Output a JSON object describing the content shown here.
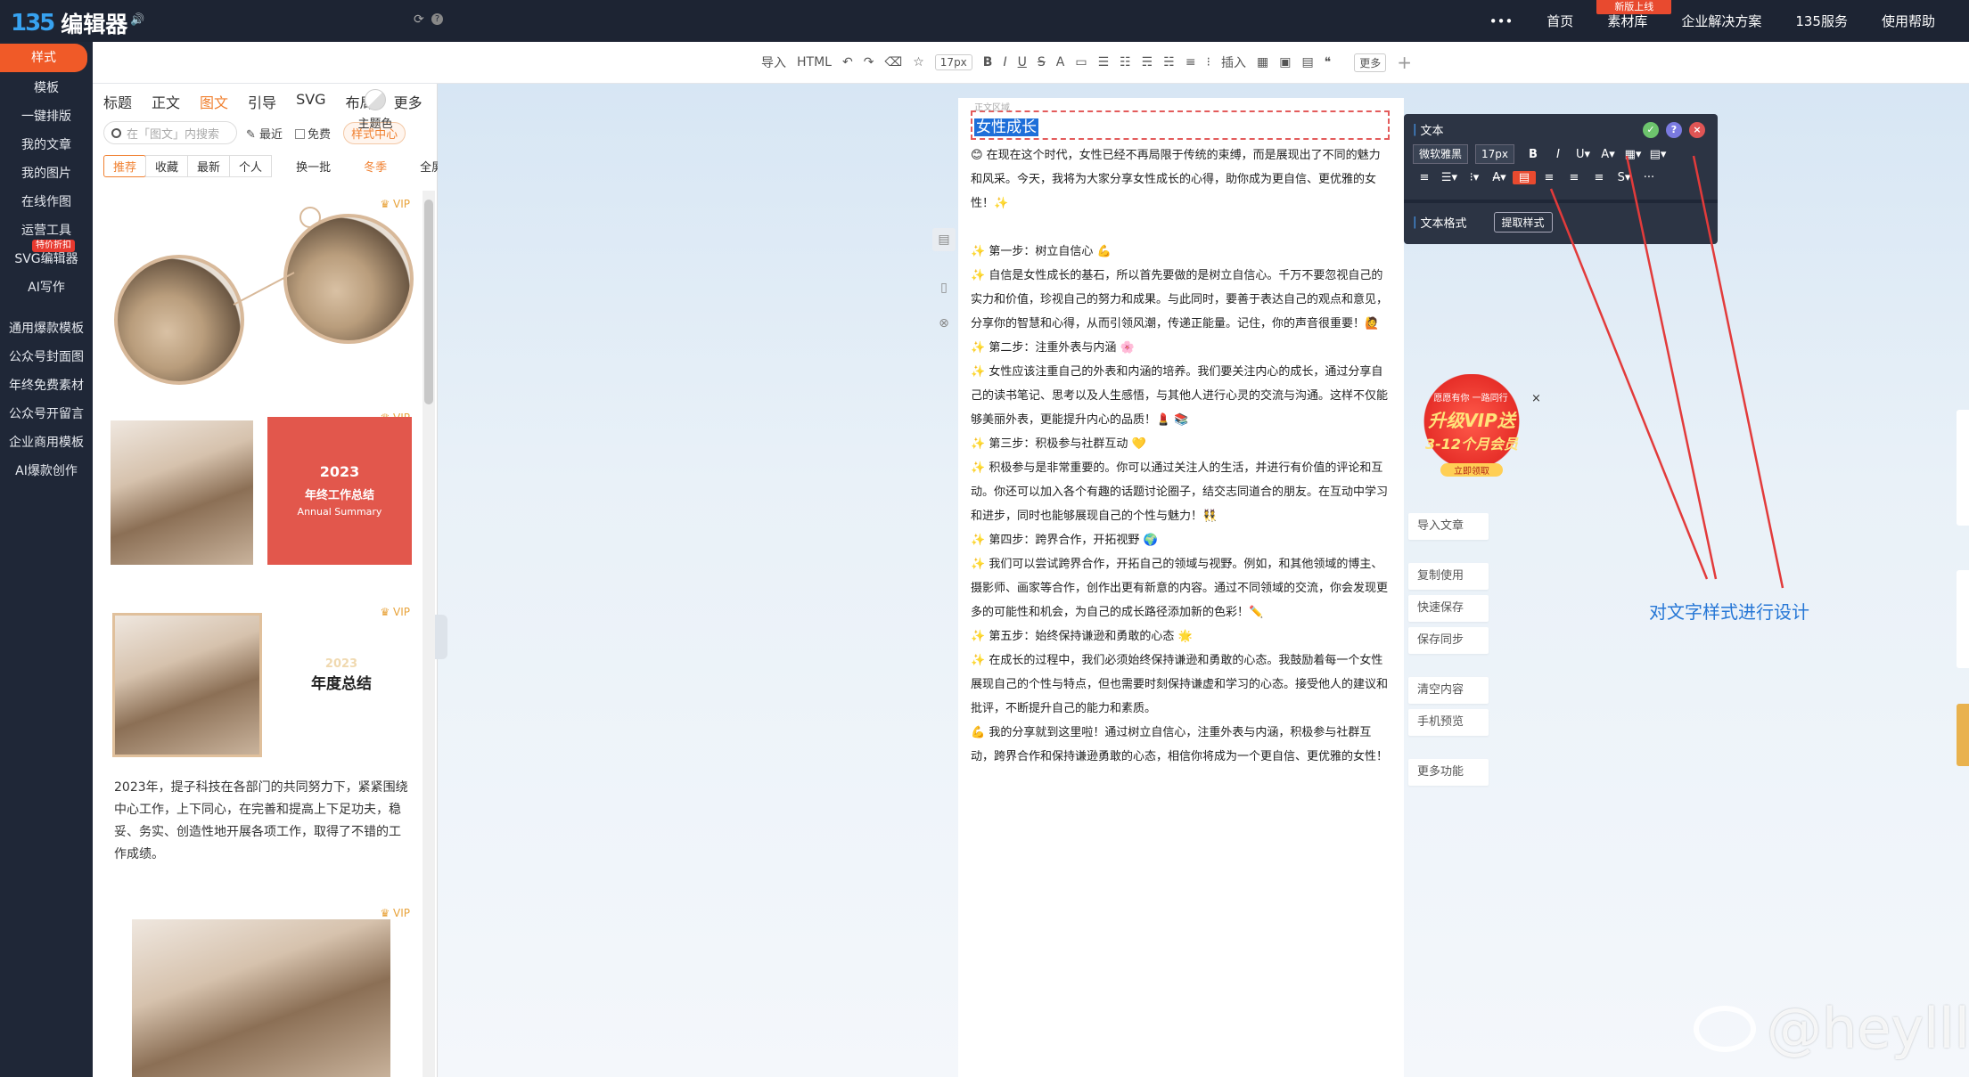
{
  "topbar": {
    "logo_mark": "135",
    "logo_text": "编辑器",
    "nav": [
      "•••",
      "首页",
      "素材库",
      "企业解决方案",
      "135服务",
      "使用帮助"
    ],
    "badge": "新版上线"
  },
  "sidebar": {
    "items": [
      "样式",
      "模板",
      "一键排版",
      "我的文章",
      "我的图片",
      "在线作图",
      "运营工具",
      "SVG编辑器",
      "AI写作"
    ],
    "hot_label": "特价折扣",
    "items2": [
      "通用爆款模板",
      "公众号封面图",
      "年终免费素材",
      "公众号开留言",
      "企业商用模板",
      "AI爆款创作"
    ]
  },
  "toolbar": {
    "items": [
      "导入",
      "HTML",
      "↶",
      "↷",
      "⌫",
      "☆",
      "17px",
      "B",
      "I",
      "U",
      "S",
      "A",
      "▭",
      "☰",
      "☷",
      "☴",
      "☵",
      "≡",
      "⁝",
      "插入",
      "▦",
      "▣",
      "▤",
      "❝"
    ],
    "more": "更多",
    "plus": "+"
  },
  "panel": {
    "tabs": [
      "标题",
      "正文",
      "图文",
      "引导",
      "SVG",
      "布局",
      "更多"
    ],
    "active_tab": 2,
    "theme": "主题色",
    "search_placeholder": "在「图文」内搜索",
    "recent": "最近",
    "free": "免费",
    "style_center": "样式中心",
    "subtabs": [
      "推荐",
      "收藏",
      "最新",
      "个人"
    ],
    "swap": "换一批",
    "winter": "冬季",
    "fullscreen": "全屏写作",
    "vip": "VIP",
    "card2": {
      "year": "2023",
      "title": "年终工作总结",
      "sub": "Annual Summary"
    },
    "card3": {
      "year": "2023",
      "title": "年度总结",
      "text": "2023年，提子科技在各部门的共同努力下，紧紧围绕中心工作，上下同心，在完善和提高上下足功夫，稳妥、务实、创造性地开展各项工作，取得了不错的工作成绩。"
    }
  },
  "doc": {
    "tiny": "正文区域",
    "title": "女性成长",
    "paragraphs": [
      "😊 在现在这个时代，女性已经不再局限于传统的束缚，而是展现出了不同的魅力和风采。今天，我将为大家分享女性成长的心得，助你成为更自信、更优雅的女性！✨",
      "",
      "✨ 第一步：树立自信心 💪",
      "✨ 自信是女性成长的基石，所以首先要做的是树立自信心。千万不要忽视自己的实力和价值，珍视自己的努力和成果。与此同时，要善于表达自己的观点和意见，分享你的智慧和心得，从而引领风潮，传递正能量。记住，你的声音很重要！🙋",
      "✨ 第二步：注重外表与内涵 🌸",
      "✨ 女性应该注重自己的外表和内涵的培养。我们要关注内心的成长，通过分享自己的读书笔记、思考以及人生感悟，与其他人进行心灵的交流与沟通。这样不仅能够美丽外表，更能提升内心的品质！💄 📚",
      "✨ 第三步：积极参与社群互动 💛",
      "✨ 积极参与是非常重要的。你可以通过关注人的生活，并进行有价值的评论和互动。你还可以加入各个有趣的话题讨论圈子，结交志同道合的朋友。在互动中学习和进步，同时也能够展现自己的个性与魅力！👯",
      "✨ 第四步：跨界合作，开拓视野 🌍",
      "✨ 我们可以尝试跨界合作，开拓自己的领域与视野。例如，和其他领域的博主、摄影师、画家等合作，创作出更有新意的内容。通过不同领域的交流，你会发现更多的可能性和机会，为自己的成长路径添加新的色彩！✏️",
      "✨ 第五步：始终保持谦逊和勇敢的心态 🌟",
      "✨ 在成长的过程中，我们必须始终保持谦逊和勇敢的心态。我鼓励着每一个女性展现自己的个性与特点，但也需要时刻保持谦虚和学习的心态。接受他人的建议和批评，不断提升自己的能力和素质。",
      "💪 我的分享就到这里啦！通过树立自信心，注重外表与内涵，积极参与社群互动，跨界合作和保持谦逊勇敢的心态，相信你将成为一个更自信、更优雅的女性！"
    ]
  },
  "format_toolbar": {
    "label": "文本",
    "font": "微软雅黑",
    "size": "17px",
    "row1": [
      "B",
      "I",
      "U▾",
      "A▾",
      "▦▾",
      "▤▾"
    ],
    "row2": [
      "≡",
      "☰▾",
      "⁝▾",
      "A̶▾",
      "▤",
      "≡",
      "≡",
      "≡",
      "S▾",
      "···"
    ],
    "label2": "文本格式",
    "extract": "提取样式"
  },
  "vip_ad": {
    "top": "愿愿有你 一路同行",
    "main": "升级VIP送",
    "sub": "3-12个月会员",
    "get": "立即领取",
    "close": "×"
  },
  "actions": [
    "导入文章",
    "复制使用",
    "快速保存",
    "保存同步",
    "清空内容",
    "手机预览",
    "更多功能"
  ],
  "annotation": "对文字样式进行设计",
  "watermark": "@heylll"
}
